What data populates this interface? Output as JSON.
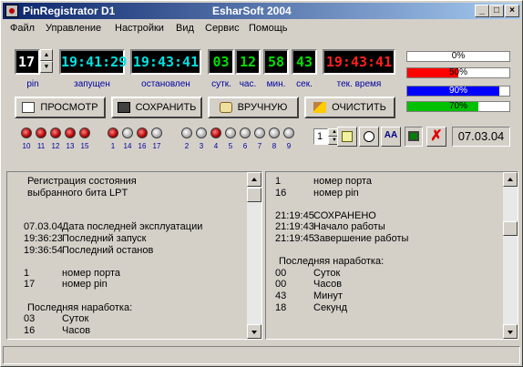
{
  "title": {
    "app": "PinRegistrator D1",
    "company": "EsharSoft 2004"
  },
  "menu": [
    "Файл",
    "Управление",
    "Настройки",
    "Вид",
    "Сервис",
    "Помощь"
  ],
  "pin": {
    "value": "17",
    "label": "pin"
  },
  "clocks": {
    "started": {
      "value": "19:41:29",
      "label": "запущен"
    },
    "stopped": {
      "value": "19:43:41",
      "label": "остановлен"
    },
    "days": {
      "value": "03",
      "label": "сутк."
    },
    "hours": {
      "value": "12",
      "label": "час."
    },
    "minutes": {
      "value": "58",
      "label": "мин."
    },
    "seconds": {
      "value": "43",
      "label": "сек."
    },
    "current": {
      "value": "19:43:41",
      "label": "тек. время"
    }
  },
  "bars": [
    {
      "text": "0%",
      "value": 0,
      "color": "#ffffff"
    },
    {
      "text": "50%",
      "value": 50,
      "color": "#ff0000"
    },
    {
      "text": "90%",
      "value": 90,
      "color": "#0000ff"
    },
    {
      "text": "70%",
      "value": 70,
      "color": "#00c000"
    }
  ],
  "buttons": {
    "view": "ПРОСМОТР",
    "save": "СОХРАНИТЬ",
    "manual": "ВРУЧНУЮ",
    "clear": "ОЧИСТИТЬ"
  },
  "leds": {
    "group1": [
      {
        "n": "10",
        "on": true
      },
      {
        "n": "11",
        "on": true
      },
      {
        "n": "12",
        "on": true
      },
      {
        "n": "13",
        "on": true
      },
      {
        "n": "15",
        "on": true
      }
    ],
    "group2": [
      {
        "n": "1",
        "on": true
      },
      {
        "n": "14",
        "on": false
      },
      {
        "n": "16",
        "on": true
      },
      {
        "n": "17",
        "on": false
      }
    ],
    "group3": [
      {
        "n": "2",
        "on": false
      },
      {
        "n": "3",
        "on": false
      },
      {
        "n": "4",
        "on": true
      },
      {
        "n": "5",
        "on": false
      },
      {
        "n": "6",
        "on": false
      },
      {
        "n": "7",
        "on": false
      },
      {
        "n": "8",
        "on": false
      },
      {
        "n": "9",
        "on": false
      }
    ]
  },
  "spinner": {
    "value": "1"
  },
  "date": "07.03.04",
  "left_log": [
    [
      "",
      "Регистрация состояния"
    ],
    [
      "",
      "  выбранного бита LPT"
    ],
    [
      "",
      ""
    ],
    [
      "",
      ""
    ],
    [
      "07.03.04",
      "Дата последней эксплуатации"
    ],
    [
      "19:36:23",
      "Последний запуск"
    ],
    [
      "19:36:54",
      "Последний останов"
    ],
    [
      "",
      ""
    ],
    [
      "1",
      "номер порта"
    ],
    [
      "17",
      "номер pin"
    ],
    [
      "",
      ""
    ],
    [
      "",
      "Последняя наработка:"
    ],
    [
      "03",
      "Суток"
    ],
    [
      "16",
      "Часов"
    ]
  ],
  "right_log": [
    [
      "1",
      "номер порта"
    ],
    [
      "16",
      "номер pin"
    ],
    [
      "",
      ""
    ],
    [
      "21:19:45",
      "СОХРАНЕНО"
    ],
    [
      "21:19:43",
      "Начало работы"
    ],
    [
      "21:19:45",
      "Завершение работы"
    ],
    [
      "",
      ""
    ],
    [
      "",
      "Последняя наработка:"
    ],
    [
      "00",
      "Суток"
    ],
    [
      "00",
      "Часов"
    ],
    [
      "43",
      "Минут"
    ],
    [
      "18",
      "Секунд"
    ]
  ]
}
